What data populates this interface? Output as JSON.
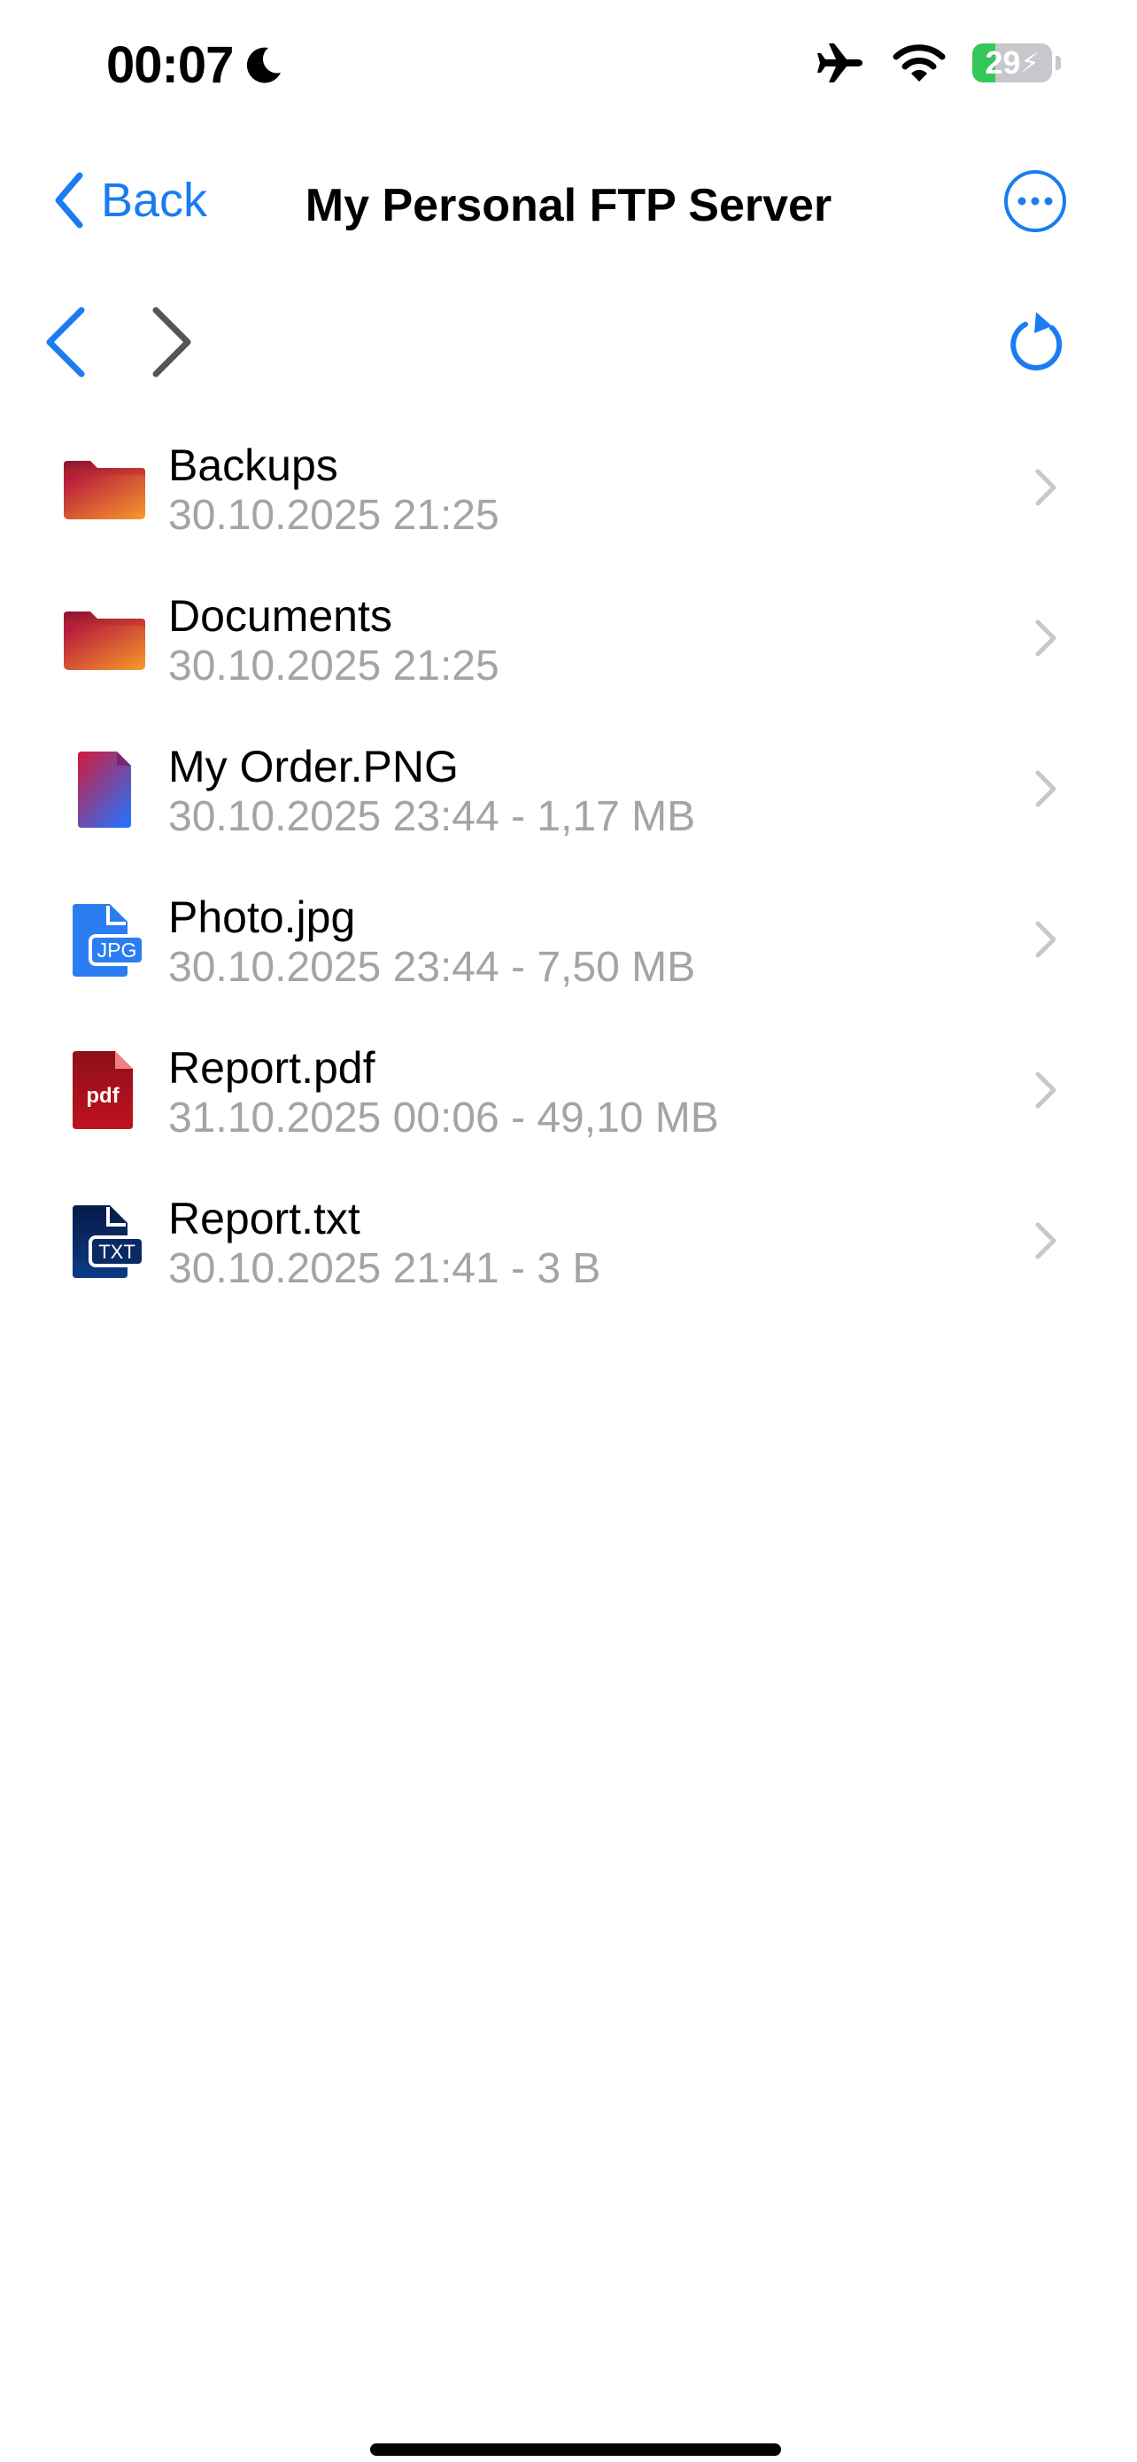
{
  "status_bar": {
    "time": "00:07",
    "battery_percent": "29",
    "battery_level": 0.29,
    "icons": [
      "moon-icon",
      "airplane-icon",
      "wifi-icon",
      "battery-charging-icon"
    ]
  },
  "nav": {
    "back_label": "Back",
    "title": "My Personal FTP Server",
    "more_icon": "ellipsis-circle-icon"
  },
  "toolbar": {
    "icons": [
      "chevron-left-icon",
      "chevron-right-icon",
      "refresh-icon"
    ]
  },
  "files": [
    {
      "name": "Backups",
      "meta": "30.10.2025 21:25",
      "icon": "folder-icon"
    },
    {
      "name": "Documents",
      "meta": "30.10.2025 21:25",
      "icon": "folder-icon"
    },
    {
      "name": "My Order.PNG",
      "meta": "30.10.2025 23:44 - 1,17 MB",
      "icon": "image-file-icon"
    },
    {
      "name": "Photo.jpg",
      "meta": "30.10.2025 23:44 - 7,50 MB",
      "icon": "jpg-file-icon",
      "icon_label": "JPG"
    },
    {
      "name": "Report.pdf",
      "meta": "31.10.2025 00:06 - 49,10 MB",
      "icon": "pdf-file-icon",
      "icon_label": "pdf"
    },
    {
      "name": "Report.txt",
      "meta": "30.10.2025 21:41 - 3 B",
      "icon": "txt-file-icon",
      "icon_label": "TXT"
    }
  ],
  "colors": {
    "accent": "#1a7cf0",
    "secondary_text": "#a3a3a8",
    "chevron": "#c7c7cc",
    "battery_green": "#34c759",
    "folder_gradient": [
      "#b3123f",
      "#f79a2a"
    ],
    "png_gradient": [
      "#c8143c",
      "#2f6df5"
    ],
    "jpg_blue": "#2b7ef2",
    "pdf_red": "#a4121c",
    "txt_navy": "#0a2a66"
  }
}
